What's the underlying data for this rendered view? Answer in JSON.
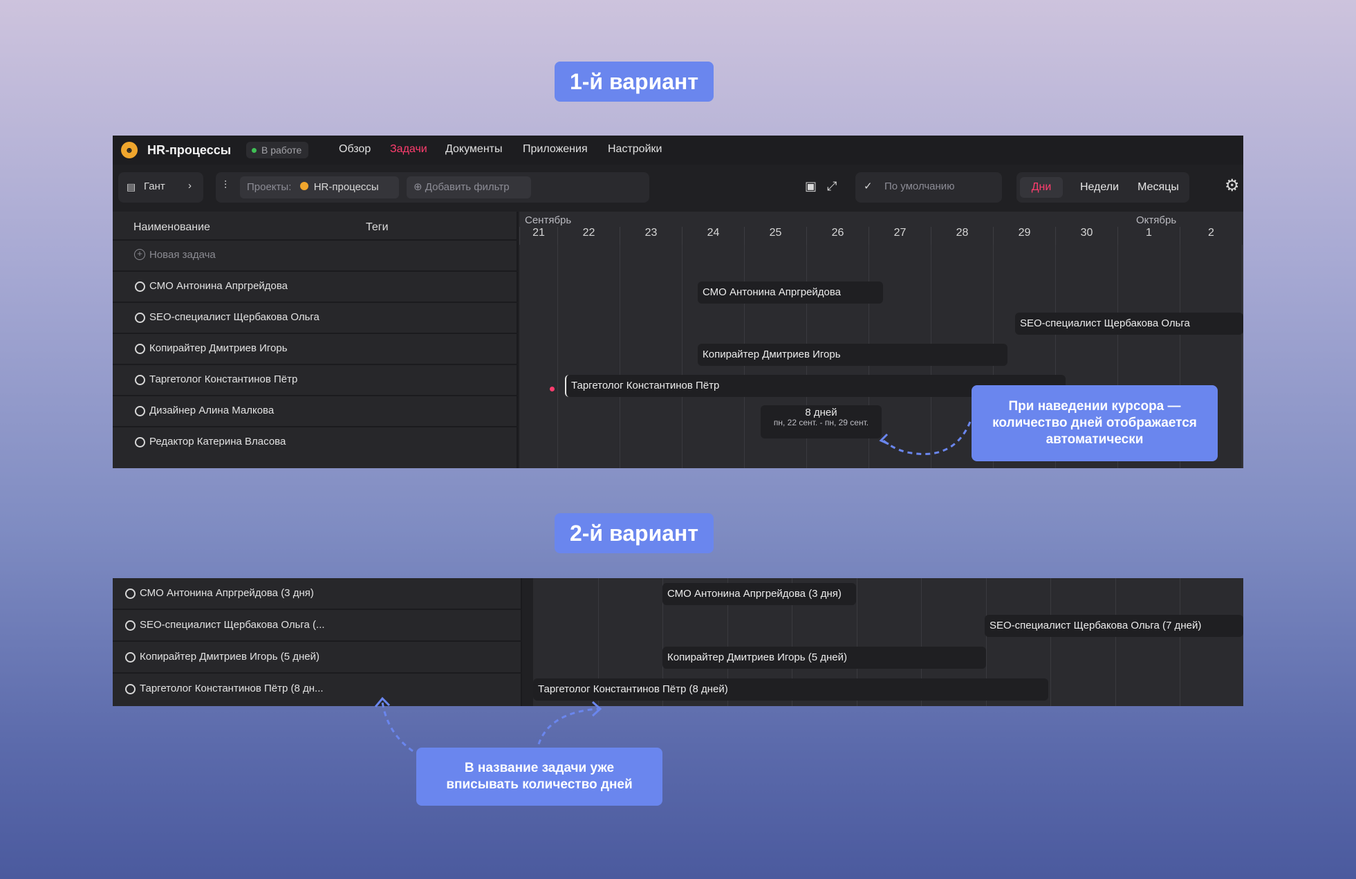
{
  "badges": {
    "variant1": "1-й вариант",
    "variant2": "2-й вариант"
  },
  "colors": {
    "accent": "#ff3d6e",
    "callout": "#6a86ee",
    "status_green": "#3fbf55"
  },
  "app": {
    "title": "HR-процессы",
    "status": "В работе",
    "nav": [
      "Обзор",
      "Задачи",
      "Документы",
      "Приложения",
      "Настройки"
    ],
    "active_nav": "Задачи"
  },
  "toolbar": {
    "view": "Гант",
    "projects_label": "Проекты:",
    "project_chip": "HR-процессы",
    "add_filter": "Добавить фильтр",
    "default_preset": "По умолчанию",
    "scale": [
      "Дни",
      "Недели",
      "Месяцы"
    ],
    "active_scale": "Дни"
  },
  "table": {
    "col_name": "Наименование",
    "col_tags": "Теги",
    "new_task": "Новая задача",
    "tasks": [
      "СМО Антонина Апргрейдова",
      "SEO-специалист Щербакова Ольга",
      "Копирайтер Дмитриев Игорь",
      "Таргетолог Константинов Пётр",
      "Дизайнер Алина Малкова",
      "Редактор Катерина Власова"
    ]
  },
  "timeline": {
    "month1": "Сентябрь",
    "month2": "Октябрь",
    "days": [
      "21",
      "22",
      "23",
      "24",
      "25",
      "26",
      "27",
      "28",
      "29",
      "30",
      "1",
      "2"
    ]
  },
  "bars1": [
    "СМО Антонина Апргрейдова",
    "SEO-специалист Щербакова Ольга",
    "Копирайтер Дмитриев Игорь",
    "Таргетолог Константинов Пётр"
  ],
  "tooltip": {
    "days": "8 дней",
    "range": "пн, 22 сент. - пн, 29 сент."
  },
  "callout1": "При наведении курсора — количество дней отображается автоматически",
  "panel2": {
    "rows": [
      "СМО Антонина Апргрейдова (3 дня)",
      "SEO-специалист Щербакова Ольга (...",
      "Копирайтер Дмитриев Игорь (5 дней)",
      "Таргетолог Константинов Пётр (8 дн..."
    ],
    "bars": [
      "СМО Антонина Апргрейдова (3 дня)",
      "SEO-специалист Щербакова Ольга (7 дней)",
      "Копирайтер Дмитриев Игорь (5 дней)",
      "Таргетолог Константинов Пётр (8 дней)"
    ]
  },
  "callout2": "В название задачи уже вписывать количество дней"
}
